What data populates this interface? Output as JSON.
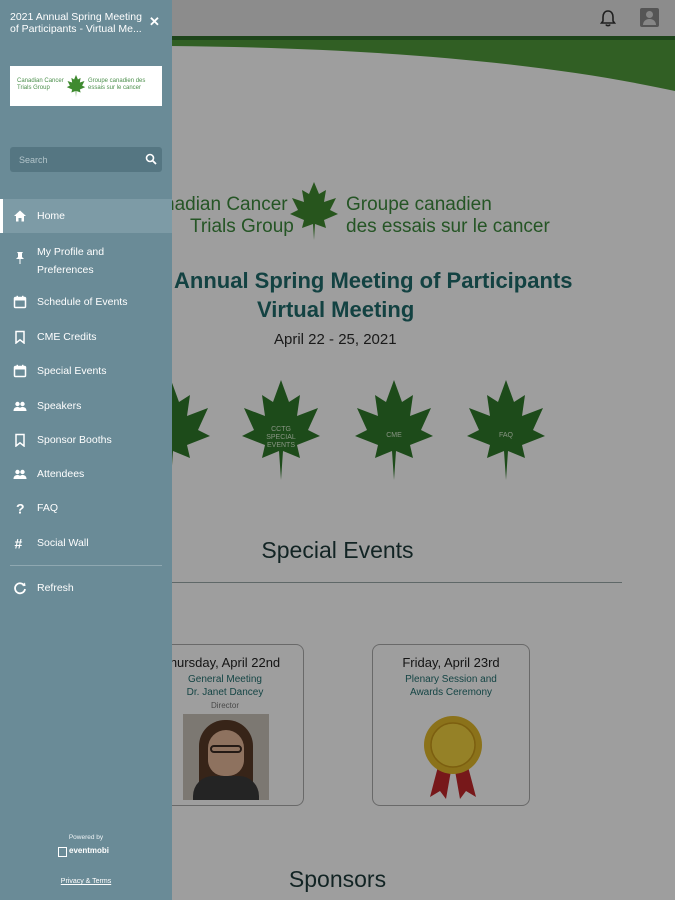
{
  "topbar": {
    "icons": [
      "bell-icon",
      "user-icon"
    ]
  },
  "hero": {
    "logo_en_line1": "nadian Cancer",
    "logo_en_line2": "Trials Group",
    "logo_fr_line1": "Groupe canadien",
    "logo_fr_line2": "des essais sur le cancer",
    "title": "Annual Spring Meeting of Participants",
    "subtitle": "Virtual Meeting",
    "dates": "April 22 - 25, 2021"
  },
  "quick_links": [
    {
      "label": ""
    },
    {
      "label": "CCTG SPECIAL EVENTS"
    },
    {
      "label": "CME"
    },
    {
      "label": "FAQ"
    }
  ],
  "special_events": {
    "heading": "Special Events",
    "cards": [
      {
        "day": "hursday,  April 22nd",
        "line1": "General Meeting",
        "line2": "Dr. Janet Dancey",
        "line3": "Director"
      },
      {
        "day": "Friday,  April 23rd",
        "line1": "Plenary Session and",
        "line2": "Awards Ceremony",
        "line3": ""
      }
    ]
  },
  "sponsors": {
    "heading": "Sponsors"
  },
  "drawer": {
    "title": "2021 Annual Spring Meeting of Participants - Virtual Me...",
    "close_icon": "close-icon",
    "logo_en": "Canadian Cancer Trials Group",
    "logo_fr": "Groupe canadien des essais sur le cancer",
    "search_placeholder": "Search",
    "items": [
      {
        "label": "Home",
        "icon": "home-icon"
      },
      {
        "label": "My Profile and Preferences",
        "icon": "pin-icon"
      },
      {
        "label": "Schedule of Events",
        "icon": "calendar-icon"
      },
      {
        "label": "CME Credits",
        "icon": "bookmark-icon"
      },
      {
        "label": "Special Events",
        "icon": "calendar-icon"
      },
      {
        "label": "Speakers",
        "icon": "people-icon"
      },
      {
        "label": "Sponsor Booths",
        "icon": "bookmark-icon"
      },
      {
        "label": "Attendees",
        "icon": "people-icon"
      },
      {
        "label": "FAQ",
        "icon": "question-icon"
      },
      {
        "label": "Social Wall",
        "icon": "hashtag-icon"
      },
      {
        "label": "Refresh",
        "icon": "refresh-icon"
      }
    ],
    "powered_by": "Powered by",
    "brand": "eventmobi",
    "privacy": "Privacy & Terms"
  },
  "colors": {
    "drawer_bg": "#6a8b97",
    "accent_green": "#3d8a3d",
    "title_teal": "#1f6b6b"
  }
}
